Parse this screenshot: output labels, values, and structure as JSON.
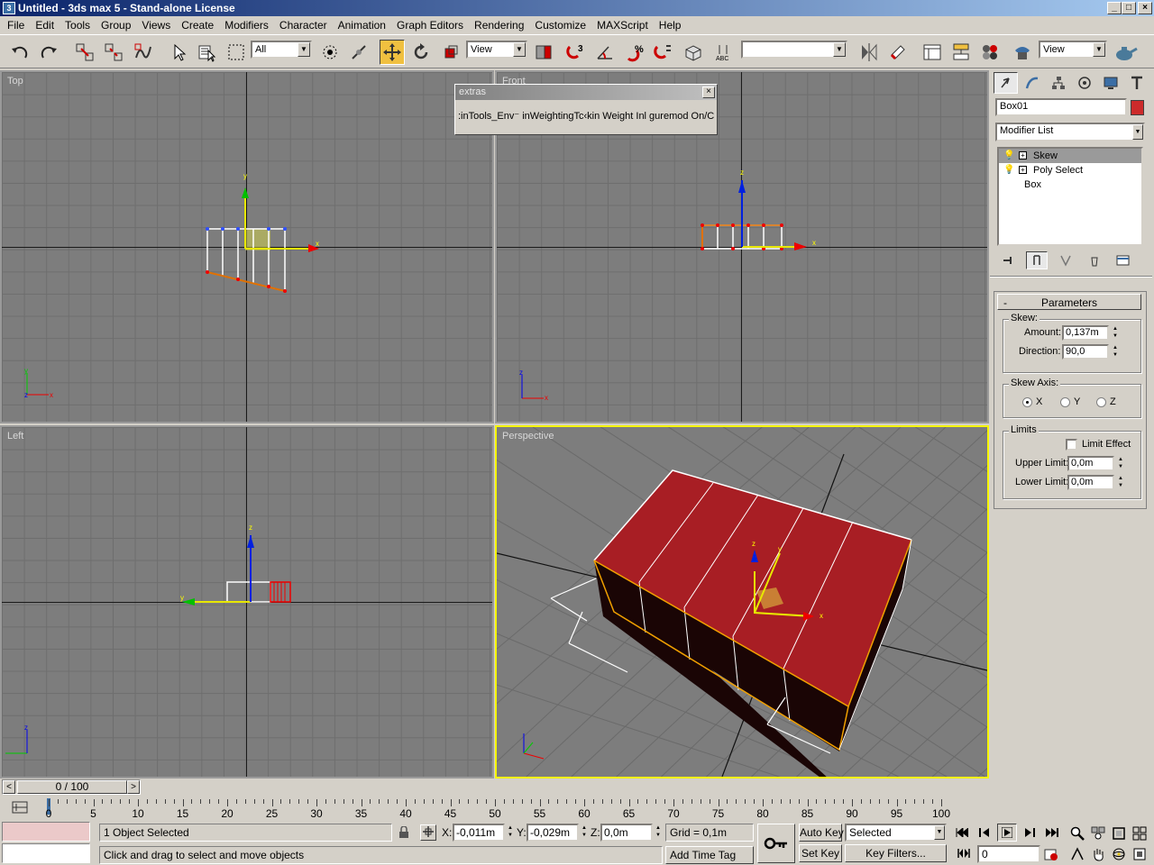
{
  "window": {
    "title": "Untitled - 3ds max 5 - Stand-alone License",
    "minimize": "_",
    "maximize": "□",
    "close": "×"
  },
  "menu": [
    "File",
    "Edit",
    "Tools",
    "Group",
    "Views",
    "Create",
    "Modifiers",
    "Character",
    "Animation",
    "Graph Editors",
    "Rendering",
    "Customize",
    "MAXScript",
    "Help"
  ],
  "toolbar": {
    "selection_filter": "All",
    "ref_coord": "View",
    "named_selection": "",
    "render_type": "View",
    "icons": [
      "undo-icon",
      "redo-icon",
      "select-link-icon",
      "unlink-icon",
      "bind-spacewarp-icon",
      "select-object-icon",
      "select-by-name-icon",
      "rectangle-region-icon",
      "window-crossing-icon",
      "select-move-icon",
      "select-rotate-icon",
      "select-scale-icon",
      "pivot-center-icon",
      "snap-3d-icon",
      "angle-snap-icon",
      "percent-snap-icon",
      "spinner-snap-icon",
      "edit-named-selection-icon",
      "mirror-icon",
      "align-icon",
      "track-view-icon",
      "schematic-view-icon",
      "material-editor-icon",
      "render-scene-icon",
      "quick-render-icon"
    ]
  },
  "viewports": {
    "top": "Top",
    "front": "Front",
    "left": "Left",
    "perspective": "Perspective"
  },
  "extras_dialog": {
    "title": "extras",
    "content": ":inTools_Env⁻ inWeightingTc‹kin Weight Inl guremod On/C",
    "close": "×"
  },
  "command_panel": {
    "object_name": "Box01",
    "object_color": "#cc2b2b",
    "modifier_list": "Modifier List",
    "stack": [
      {
        "label": "Skew",
        "selected": true
      },
      {
        "label": "Poly Select",
        "selected": false
      },
      {
        "label": "Box",
        "selected": false
      }
    ],
    "parameters": {
      "rollout_title": "Parameters",
      "rollout_toggle": "-",
      "skew_group": "Skew:",
      "amount_label": "Amount:",
      "amount_value": "0,137m",
      "direction_label": "Direction:",
      "direction_value": "90,0",
      "skew_axis_group": "Skew Axis:",
      "axis_x": "X",
      "axis_y": "Y",
      "axis_z": "Z",
      "selected_axis": "X",
      "limits_group": "Limits",
      "limit_effect": "Limit Effect",
      "upper_limit_label": "Upper Limit:",
      "upper_limit_value": "0,0m",
      "lower_limit_label": "Lower Limit:",
      "lower_limit_value": "0,0m"
    }
  },
  "timeline": {
    "frame_counter": "0 / 100",
    "prev": "<",
    "next": ">",
    "ticks": [
      "0",
      "5",
      "10",
      "15",
      "20",
      "25",
      "30",
      "35",
      "40",
      "45",
      "50",
      "55",
      "60",
      "65",
      "70",
      "75",
      "80",
      "85",
      "90",
      "95",
      "100"
    ]
  },
  "status": {
    "selection": "1 Object Selected",
    "prompt": "Click and drag to select and move objects",
    "x_label": "X:",
    "x_value": "-0,011m",
    "y_label": "Y:",
    "y_value": "-0,029m",
    "z_label": "Z:",
    "z_value": "0,0m",
    "grid": "Grid = 0,1m",
    "add_time_tag": "Add Time Tag",
    "auto_key": "Auto Key",
    "set_key": "Set Key",
    "key_mode": "Selected",
    "key_filters": "Key Filters...",
    "current_frame": "0"
  },
  "colors": {
    "box_top": "#a81e24",
    "box_side": "#1a0505",
    "active_viewport": "#f5f500",
    "axis_x": "#e00000",
    "axis_y": "#00c000",
    "axis_z": "#0000e0"
  }
}
